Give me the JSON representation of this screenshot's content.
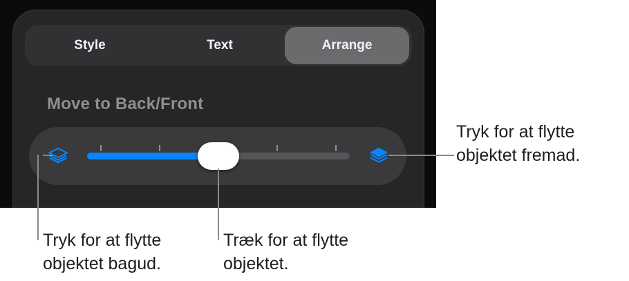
{
  "tabs": [
    {
      "label": "Style",
      "selected": false
    },
    {
      "label": "Text",
      "selected": false
    },
    {
      "label": "Arrange",
      "selected": true
    }
  ],
  "section": {
    "title": "Move to Back/Front"
  },
  "slider": {
    "position": 0.5,
    "tick_count": 4,
    "back_icon": "layers-back-icon",
    "front_icon": "layers-front-icon",
    "accent_color": "#0a84ff"
  },
  "callouts": {
    "front": {
      "line1": "Tryk for at flytte",
      "line2": "objektet fremad."
    },
    "back": {
      "line1": "Tryk for at flytte",
      "line2": "objektet bagud."
    },
    "drag": {
      "line1": "Træk for at flytte",
      "line2": "objektet."
    }
  }
}
